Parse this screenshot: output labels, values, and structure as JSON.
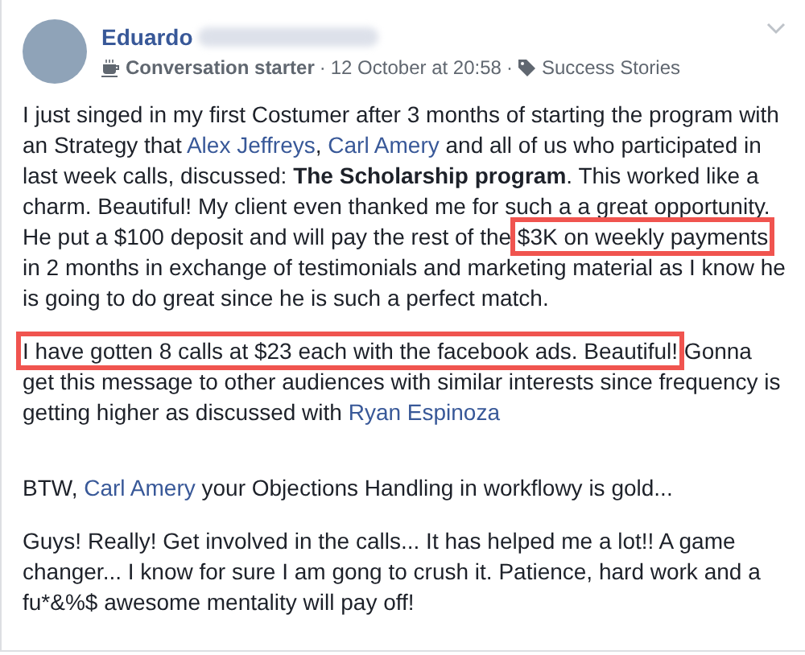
{
  "post": {
    "author": "Eduardo",
    "badge": "Conversation starter",
    "time": "12 October at 20:58",
    "topic": "Success Stories",
    "separator": "·",
    "paragraphs": [
      [
        {
          "kind": "text",
          "text": "I just singed in my first Costumer after 3 months of starting the program with an Strategy that "
        },
        {
          "kind": "link",
          "text": "Alex Jeffreys"
        },
        {
          "kind": "text",
          "text": ", "
        },
        {
          "kind": "link",
          "text": "Carl Amery"
        },
        {
          "kind": "text",
          "text": " and all of us who participated in last week calls, discussed: "
        },
        {
          "kind": "bold",
          "text": "The Scholarship program"
        },
        {
          "kind": "text",
          "text": ". This worked like a charm. Beautiful! My client even thanked me for such a a great opportunity. He put a $100 deposit and will pay the rest of the "
        },
        {
          "kind": "highlight",
          "text": "$3K on weekly payments"
        },
        {
          "kind": "text",
          "text": " in 2 months in exchange of testimonials and marketing material as I know he is going to do great since he is such a perfect match."
        }
      ],
      [
        {
          "kind": "highlight",
          "text": "I have gotten 8 calls at $23 each with the facebook ads. Beautiful!"
        },
        {
          "kind": "text",
          "text": " Gonna get this message to other audiences with similar interests since frequency is getting higher as discussed with "
        },
        {
          "kind": "link",
          "text": "Ryan Espinoza"
        }
      ],
      [
        {
          "kind": "text",
          "text": "BTW, "
        },
        {
          "kind": "link",
          "text": "Carl Amery"
        },
        {
          "kind": "text",
          "text": " your Objections Handling in workflowy is gold..."
        }
      ],
      [
        {
          "kind": "text",
          "text": "Guys! Really! Get involved in the calls... It has helped me a lot!! A game changer... I know for sure I am gong to crush it. Patience, hard work and a fu*&%$ awesome mentality will pay off!"
        }
      ]
    ]
  }
}
